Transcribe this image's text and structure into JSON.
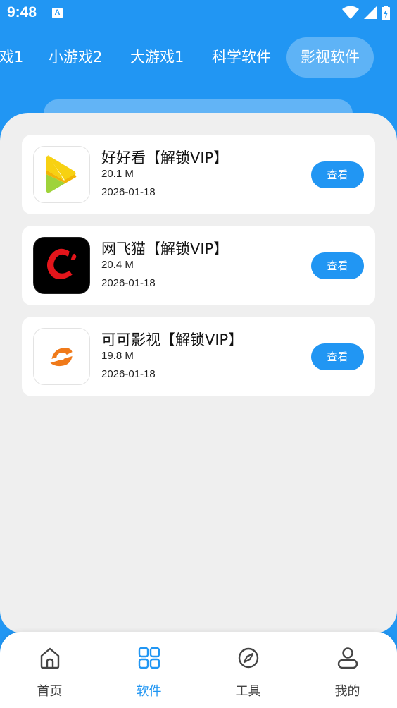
{
  "status_bar": {
    "time": "9:48",
    "notification_icon": "a-letter-icon",
    "icons": [
      "wifi-icon",
      "signal-icon",
      "battery-charging-icon"
    ]
  },
  "tabs": [
    {
      "label": "戏1",
      "active": false
    },
    {
      "label": "小游戏2",
      "active": false
    },
    {
      "label": "大游戏1",
      "active": false
    },
    {
      "label": "科学软件",
      "active": false
    },
    {
      "label": "影视软件",
      "active": true
    }
  ],
  "apps": [
    {
      "name": "好好看【解锁VIP】",
      "size": "20.1 M",
      "date": "2026-01-18",
      "button": "查看",
      "icon": "haohaokan-icon"
    },
    {
      "name": "网飞猫【解锁VIP】",
      "size": "20.4 M",
      "date": "2026-01-18",
      "button": "查看",
      "icon": "wangfeimao-icon"
    },
    {
      "name": "可可影视【解锁VIP】",
      "size": "19.8 M",
      "date": "2026-01-18",
      "button": "查看",
      "icon": "keke-icon"
    }
  ],
  "bottom_nav": [
    {
      "label": "首页",
      "icon": "home-icon",
      "active": false
    },
    {
      "label": "软件",
      "icon": "grid-icon",
      "active": true
    },
    {
      "label": "工具",
      "icon": "compass-icon",
      "active": false
    },
    {
      "label": "我的",
      "icon": "user-icon",
      "active": false
    }
  ],
  "colors": {
    "primary": "#2196F3",
    "background": "#EFEFEF",
    "card": "#FFFFFF"
  }
}
